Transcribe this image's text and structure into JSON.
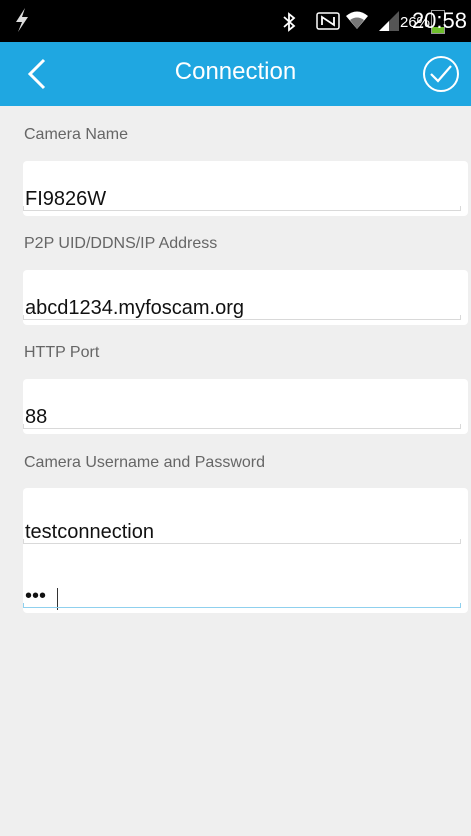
{
  "status_bar": {
    "time": "20:58",
    "battery_percent": "26%",
    "battery_level": 0.26,
    "icons": [
      "charging-bolt-icon",
      "bluetooth-icon",
      "nfc-icon",
      "wifi-icon",
      "signal-icon",
      "battery-icon"
    ]
  },
  "app_bar": {
    "title": "Connection",
    "background": "#1fa7e1",
    "back_icon": "chevron-left-icon",
    "confirm_icon": "check-circle-icon"
  },
  "form": {
    "camera_name": {
      "label": "Camera Name",
      "value": "FI9826W"
    },
    "address": {
      "label": "P2P UID/DDNS/IP Address",
      "value": "abcd1234.myfoscam.org"
    },
    "http_port": {
      "label": "HTTP Port",
      "value": "88"
    },
    "credentials": {
      "label": "Camera Username and Password",
      "username": "testconnection",
      "password": "•••"
    }
  }
}
